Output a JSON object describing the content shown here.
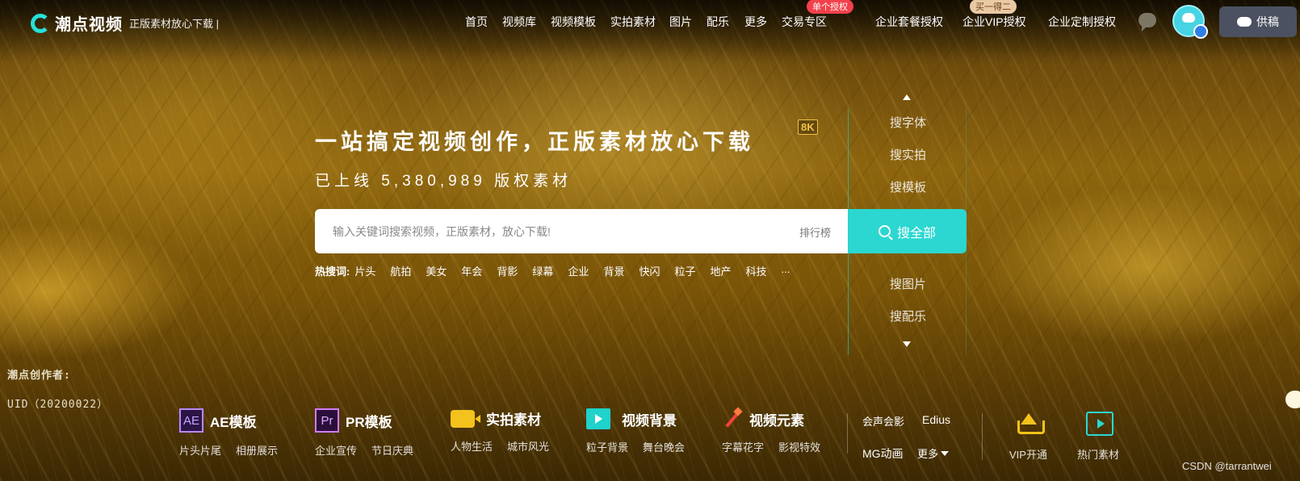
{
  "header": {
    "logo_text": "潮点视频",
    "slogan": "正版素材放心下载 |",
    "nav": [
      {
        "label": "首页"
      },
      {
        "label": "视频库"
      },
      {
        "label": "视频模板"
      },
      {
        "label": "实拍素材"
      },
      {
        "label": "图片"
      },
      {
        "label": "配乐"
      },
      {
        "label": "更多"
      },
      {
        "label": "交易专区"
      },
      {
        "label": "企业套餐授权"
      },
      {
        "label": "企业VIP授权"
      },
      {
        "label": "企业定制授权"
      }
    ],
    "tag_single_license": "单个授权",
    "tag_buy_one_get_two": "买一得二",
    "supply_label": "供稿"
  },
  "hero": {
    "title": "一站搞定视频创作，正版素材放心下载",
    "badge": "8K",
    "subtitle": "已上线 5,380,989 版权素材"
  },
  "search": {
    "placeholder": "输入关键词搜索视频，正版素材，放心下载!",
    "rank_label": "排行榜",
    "button_label": "搜全部"
  },
  "hot_search": {
    "label": "热搜词:",
    "items": [
      "片头",
      "航拍",
      "美女",
      "年会",
      "背影",
      "绿幕",
      "企业",
      "背景",
      "快闪",
      "粒子",
      "地产",
      "科技",
      "..."
    ]
  },
  "side_search": {
    "items": [
      "搜字体",
      "搜实拍",
      "搜模板",
      "搜图片",
      "搜配乐"
    ]
  },
  "creator": {
    "label": "潮点创作者:",
    "uid": "UID（20200022）"
  },
  "categories": [
    {
      "icon": "AE",
      "title": "AE模板",
      "subs": [
        "片头片尾",
        "相册展示"
      ]
    },
    {
      "icon": "Pr",
      "title": "PR模板",
      "subs": [
        "企业宣传",
        "节日庆典"
      ]
    },
    {
      "title": "实拍素材",
      "subs": [
        "人物生活",
        "城市风光"
      ]
    },
    {
      "title": "视频背景",
      "subs": [
        "粒子背景",
        "舞台晚会"
      ]
    },
    {
      "title": "视频元素",
      "subs": [
        "字幕花字",
        "影视特效"
      ]
    }
  ],
  "misc_links": {
    "huisheng": "会声会影",
    "edius": "Edius",
    "mg": "MG动画",
    "more": "更多"
  },
  "quick": {
    "vip": "VIP开通",
    "hot_material": "热门素材"
  },
  "watermark": "CSDN @tarrantwei",
  "colors": {
    "accent": "#2bd7d0",
    "tag_red": "#f2414b",
    "tag_tan": "#e9c9a3",
    "badge_gold": "#f0c24a"
  }
}
